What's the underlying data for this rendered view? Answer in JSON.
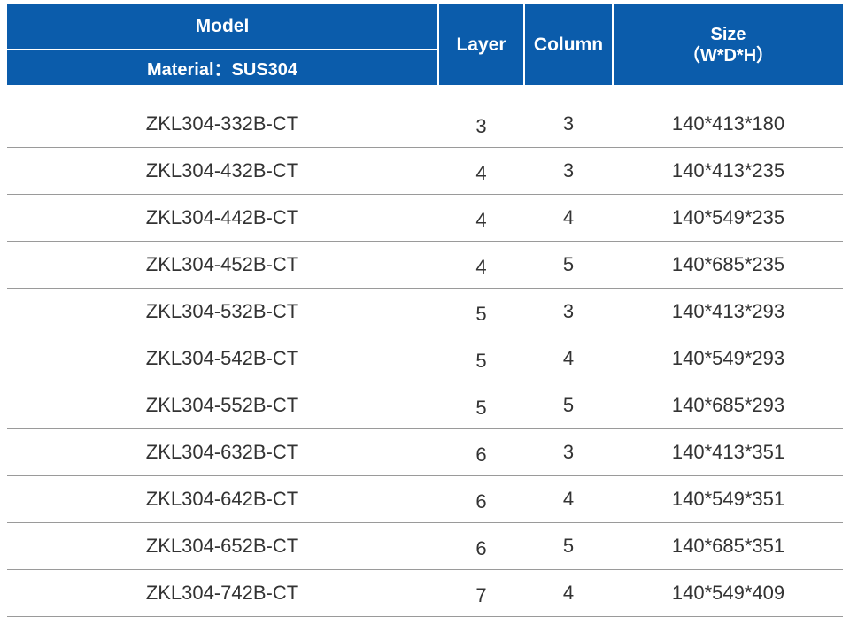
{
  "header": {
    "model": "Model",
    "material": "Material：SUS304",
    "layer": "Layer",
    "column": "Column",
    "size_line1": "Size",
    "size_line2": "（W*D*H）"
  },
  "rows": [
    {
      "model": "ZKL304-332B-CT",
      "layer": "3",
      "column": "3",
      "size": "140*413*180"
    },
    {
      "model": "ZKL304-432B-CT",
      "layer": "4",
      "column": "3",
      "size": "140*413*235"
    },
    {
      "model": "ZKL304-442B-CT",
      "layer": "4",
      "column": "4",
      "size": "140*549*235"
    },
    {
      "model": "ZKL304-452B-CT",
      "layer": "4",
      "column": "5",
      "size": "140*685*235"
    },
    {
      "model": "ZKL304-532B-CT",
      "layer": "5",
      "column": "3",
      "size": "140*413*293"
    },
    {
      "model": "ZKL304-542B-CT",
      "layer": "5",
      "column": "4",
      "size": "140*549*293"
    },
    {
      "model": "ZKL304-552B-CT",
      "layer": "5",
      "column": "5",
      "size": "140*685*293"
    },
    {
      "model": "ZKL304-632B-CT",
      "layer": "6",
      "column": "3",
      "size": "140*413*351"
    },
    {
      "model": "ZKL304-642B-CT",
      "layer": "6",
      "column": "4",
      "size": "140*549*351"
    },
    {
      "model": "ZKL304-652B-CT",
      "layer": "6",
      "column": "5",
      "size": "140*685*351"
    },
    {
      "model": "ZKL304-742B-CT",
      "layer": "7",
      "column": "4",
      "size": "140*549*409"
    }
  ],
  "colors": {
    "header_bg": "#0b5cab",
    "header_text": "#ffffff",
    "body_text": "#333333",
    "row_rule": "#9a9a9a"
  }
}
